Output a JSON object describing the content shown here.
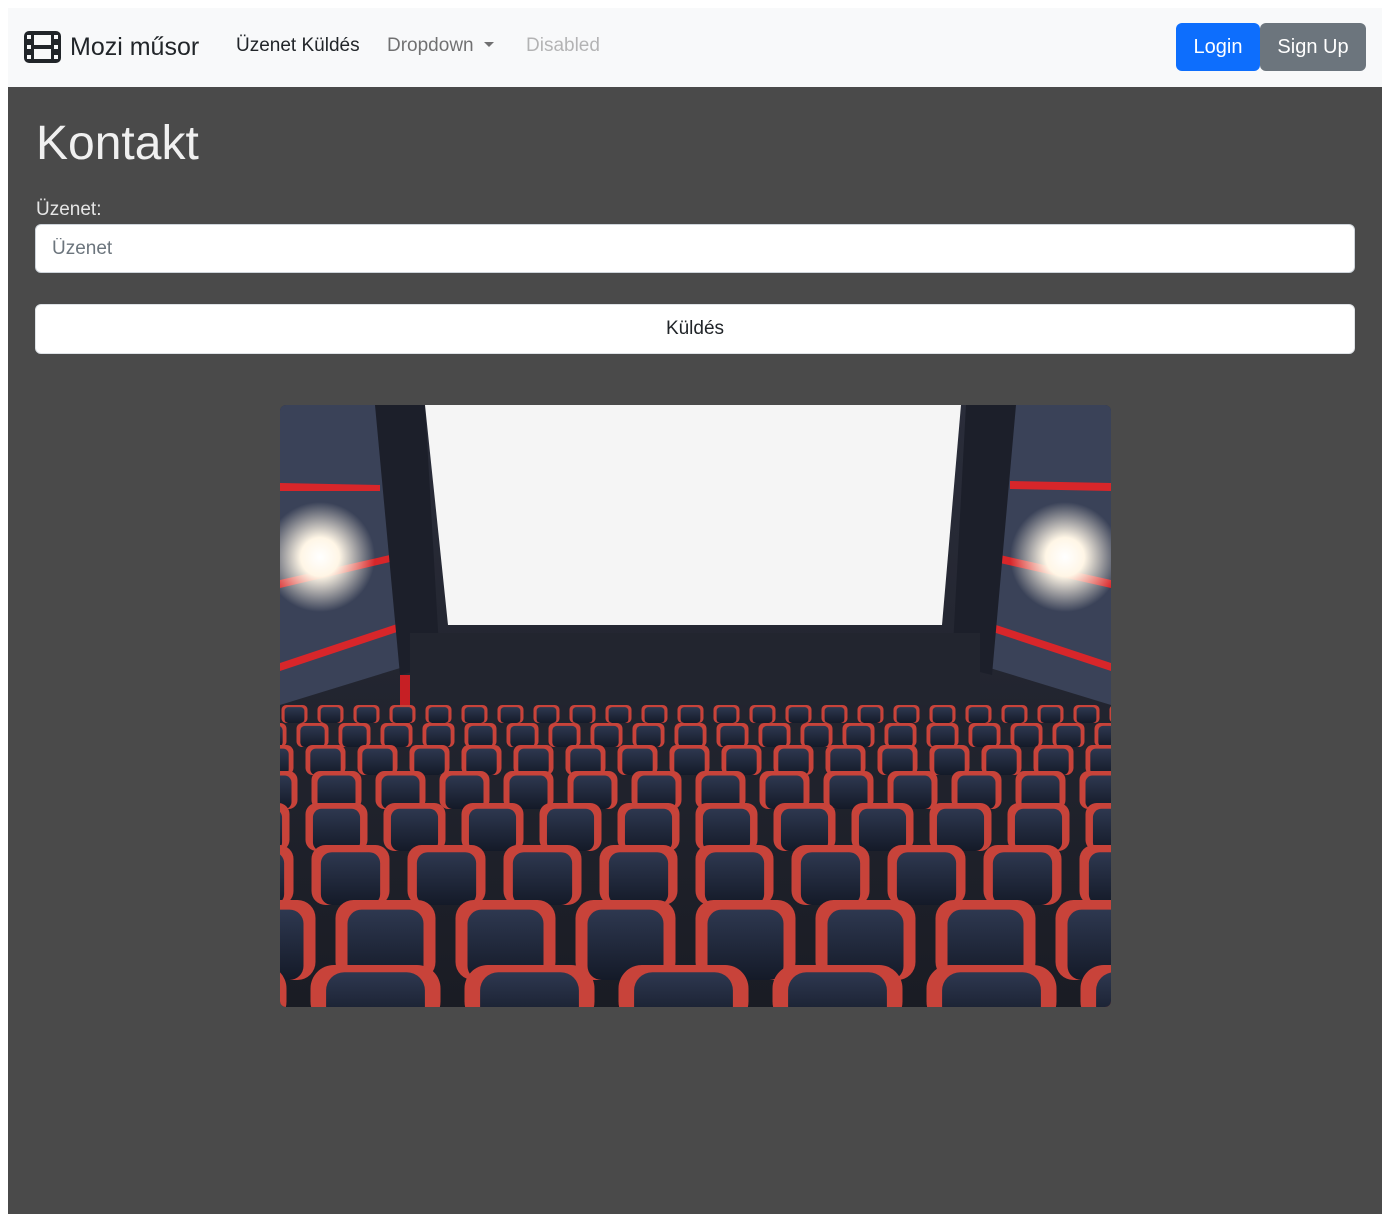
{
  "navbar": {
    "brand_text": "Mozi műsor",
    "brand_icon": "film-icon",
    "links": [
      {
        "label": "Üzenet Küldés",
        "state": "active"
      },
      {
        "label": "Dropdown",
        "state": "dropdown"
      },
      {
        "label": "Disabled",
        "state": "disabled"
      }
    ],
    "login_label": "Login",
    "signup_label": "Sign Up"
  },
  "main": {
    "title": "Kontakt",
    "message_label": "Üzenet:",
    "message_placeholder": "Üzenet",
    "message_value": "",
    "send_label": "Küldés",
    "image": "cinema-auditorium-photo"
  },
  "colors": {
    "page_bg": "#4a4a4a",
    "navbar_bg": "#f8f9fa",
    "primary": "#0d6efd",
    "secondary": "#6c757d"
  }
}
